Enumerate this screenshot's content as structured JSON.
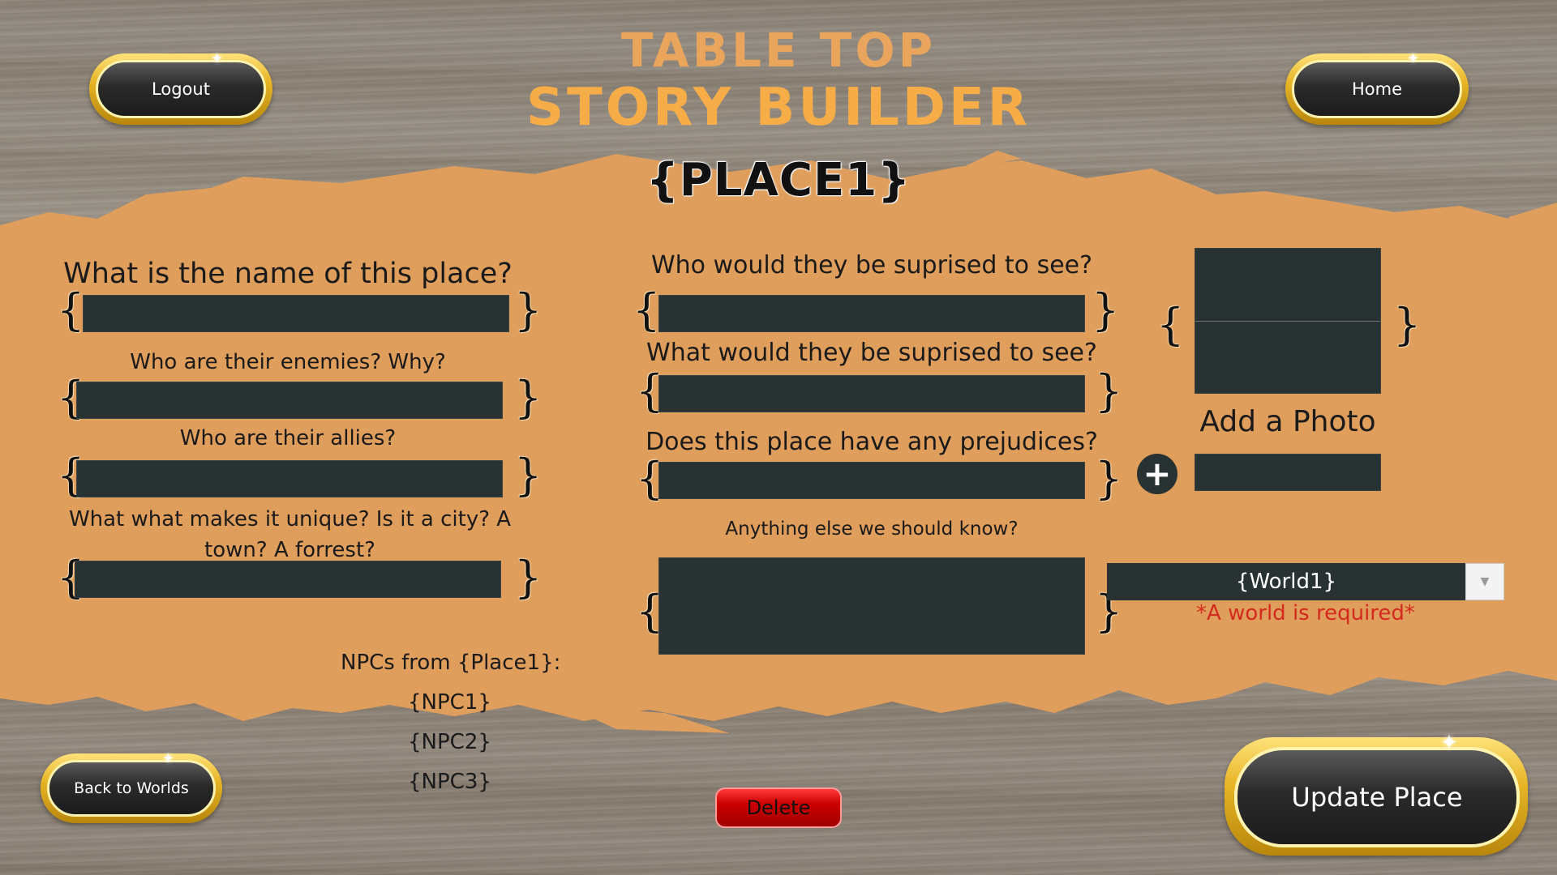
{
  "app": {
    "title_line1": "TABLE TOP",
    "title_line2": "STORY BUILDER",
    "place_title": "{PLACE1}"
  },
  "nav": {
    "logout_label": "Logout",
    "home_label": "Home",
    "back_label": "Back to Worlds",
    "update_label": "Update Place",
    "delete_label": "Delete"
  },
  "form": {
    "left": {
      "name_question": "What is the name of this place?",
      "enemies_question": "Who are their enemies? Why?",
      "allies_question": "Who are their allies?",
      "unique_question": "What what makes it unique? Is it a city? A town? A forrest?"
    },
    "middle": {
      "surprised_who_question": "Who would they be suprised to see?",
      "surprised_what_question": "What would they be suprised to see?",
      "prejudices_question": "Does this place have any prejudices?",
      "anything_else_question": "Anything else we should know?"
    },
    "photo": {
      "add_photo_label": "Add a Photo",
      "plus_symbol": "+"
    },
    "world_select": {
      "selected": "{World1}",
      "required_text": "*A world is required*"
    },
    "braces": {
      "open": "{",
      "close": "}"
    }
  },
  "npcs": {
    "heading": "NPCs from {Place1}:",
    "items": [
      "{NPC1}",
      "{NPC2}",
      "{NPC3}"
    ]
  },
  "colors": {
    "splash": "#e09e5c",
    "field": "#283232",
    "title": "#f6ad48",
    "gold": "#e7b526",
    "error": "#d42a1e",
    "delete": "#cc0000"
  },
  "icons": {
    "plus": "plus-icon",
    "dropdown": "chevron-down-icon",
    "sparkle": "sparkle-icon"
  }
}
